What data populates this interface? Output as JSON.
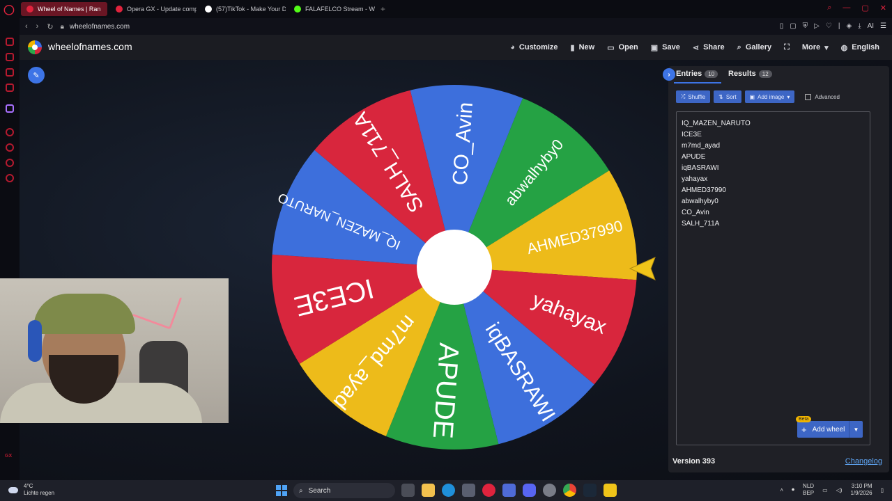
{
  "browser": {
    "tabs": [
      {
        "title": "Wheel of Names | Ran",
        "favicon_color": "#e0233d",
        "active": true
      },
      {
        "title": "Opera GX - Update comp",
        "favicon_color": "#e0233d",
        "active": false
      },
      {
        "title": "(57)TikTok - Make Your D",
        "favicon_color": "#ffffff",
        "active": false
      },
      {
        "title": "FALAFELCO Stream - Wat",
        "favicon_color": "#53fc18",
        "active": false
      }
    ],
    "new_tab_label": "+",
    "url": "wheelofnames.com",
    "ai_label": "AI"
  },
  "site": {
    "title": "wheelofnames.com",
    "menu": [
      {
        "label": "Customize",
        "icon": "palette-icon",
        "glyph": "◕"
      },
      {
        "label": "New",
        "icon": "file-icon",
        "glyph": "▮"
      },
      {
        "label": "Open",
        "icon": "folder-icon",
        "glyph": "▭"
      },
      {
        "label": "Save",
        "icon": "save-icon",
        "glyph": "▣"
      },
      {
        "label": "Share",
        "icon": "share-icon",
        "glyph": "⋖"
      },
      {
        "label": "Gallery",
        "icon": "search-icon",
        "glyph": "⌕"
      },
      {
        "label": "",
        "icon": "fullscreen-icon",
        "glyph": "⛶"
      },
      {
        "label": "More",
        "icon": "chevron-down-icon",
        "glyph": "▾"
      },
      {
        "label": "English",
        "icon": "globe-icon",
        "glyph": "◍"
      }
    ]
  },
  "wheel": {
    "colors": {
      "blue": "#3d6fdc",
      "green": "#25a244",
      "yellow": "#edbb1a",
      "red": "#d8263d"
    },
    "segments": [
      {
        "label": "CO_Avin",
        "color": "#3d6fdc"
      },
      {
        "label": "abwalhyby0",
        "color": "#25a244"
      },
      {
        "label": "AHMED37990",
        "color": "#edbb1a"
      },
      {
        "label": "yahayax",
        "color": "#d8263d"
      },
      {
        "label": "iqBASRAWI",
        "color": "#3d6fdc"
      },
      {
        "label": "APUDE",
        "color": "#25a244"
      },
      {
        "label": "m7md_ayad",
        "color": "#edbb1a"
      },
      {
        "label": "ICE3E",
        "color": "#d8263d"
      },
      {
        "label": "IQ_MAZEN_NARUTO",
        "color": "#3d6fdc"
      },
      {
        "label": "SALH_711A",
        "color": "#d8263d"
      }
    ],
    "pointer_color": "#f0c419"
  },
  "panel": {
    "tabs": [
      {
        "label": "Entries",
        "count": "10"
      },
      {
        "label": "Results",
        "count": "12"
      }
    ],
    "toolbar": {
      "shuffle": "Shuffle",
      "sort": "Sort",
      "add_image": "Add image",
      "advanced": "Advanced"
    },
    "entries": [
      "IQ_MAZEN_NARUTO",
      "ICE3E",
      "m7md_ayad",
      "APUDE",
      "iqBASRAWI",
      "yahayax",
      "AHMED37990",
      "abwalhyby0",
      "CO_Avin",
      "SALH_711A"
    ],
    "beta_badge": "Beta",
    "add_wheel": "Add wheel",
    "version": "Version 393",
    "changelog": "Changelog"
  },
  "taskbar": {
    "weather_temp": "4°C",
    "weather_desc": "Lichte regen",
    "search_label": "Search",
    "lang_1": "NLD",
    "lang_2": "BEP",
    "time": "3:10 PM",
    "date": "1/9/2026"
  }
}
